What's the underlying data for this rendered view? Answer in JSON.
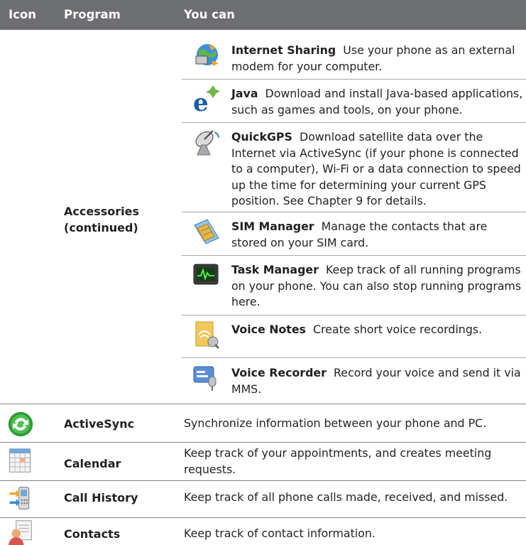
{
  "header": {
    "col_icon": "Icon",
    "col_program": "Program",
    "col_you_can": "You can"
  },
  "accessories": {
    "program": "Accessories (continued)",
    "items": [
      {
        "icon": "internet-sharing-icon",
        "title": "Internet Sharing",
        "desc": "Use your phone as an external modem for your computer."
      },
      {
        "icon": "java-icon",
        "title": "Java",
        "desc": "Download and install Java-based applications, such as games and tools, on your phone."
      },
      {
        "icon": "quickgps-satellite-icon",
        "title": "QuickGPS",
        "desc": "Download satellite data over the Internet via ActiveSync (if your phone is connected to a computer), Wi-Fi or a data connection to speed up the time for determining your current GPS position. See Chapter 9 for details."
      },
      {
        "icon": "sim-manager-icon",
        "title": "SIM Manager",
        "desc": "Manage the contacts that are stored on your SIM card."
      },
      {
        "icon": "task-manager-icon",
        "title": "Task Manager",
        "desc": "Keep track of all running programs on your phone. You can also stop running programs here."
      },
      {
        "icon": "voice-notes-icon",
        "title": "Voice Notes",
        "desc": "Create short voice recordings."
      },
      {
        "icon": "voice-recorder-icon",
        "title": "Voice Recorder",
        "desc": "Record your voice and send it via MMS."
      }
    ]
  },
  "rows": [
    {
      "icon": "activesync-icon",
      "program": "ActiveSync",
      "desc": "Synchronize information between your phone and PC."
    },
    {
      "icon": "calendar-icon",
      "program": "Calendar",
      "desc": "Keep track of your appointments, and creates meeting requests."
    },
    {
      "icon": "call-history-icon",
      "program": "Call History",
      "desc": "Keep track of all phone calls made, received, and missed."
    },
    {
      "icon": "contacts-icon",
      "program": "Contacts",
      "desc": "Keep track of contact information."
    }
  ]
}
